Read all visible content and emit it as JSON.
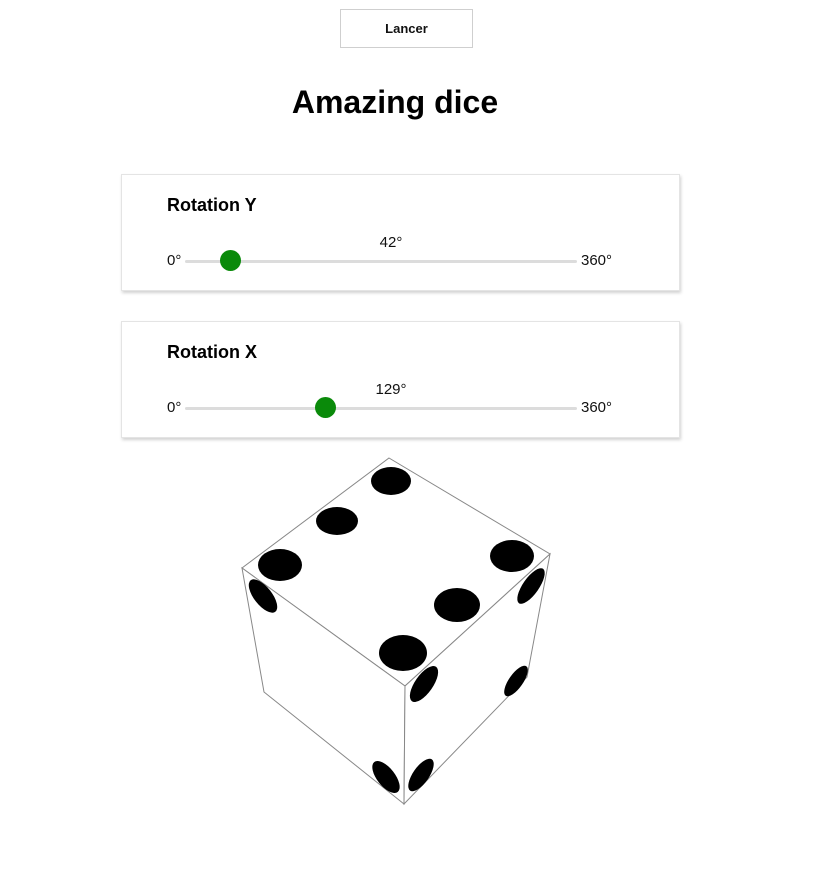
{
  "toolbar": {
    "roll_label": "Lancer"
  },
  "page": {
    "title": "Amazing dice"
  },
  "sliders": {
    "rotation_y": {
      "label": "Rotation Y",
      "value": 42,
      "value_text": "42°",
      "min_label": "0°",
      "max_label": "360°",
      "max": 360
    },
    "rotation_x": {
      "label": "Rotation X",
      "value": 129,
      "value_text": "129°",
      "min_label": "0°",
      "max_label": "360°",
      "max": 360
    }
  },
  "colors": {
    "accent": "#0a8a0a",
    "track": "#dcdcdc",
    "pip": "#000000",
    "die_edge": "#888888"
  }
}
